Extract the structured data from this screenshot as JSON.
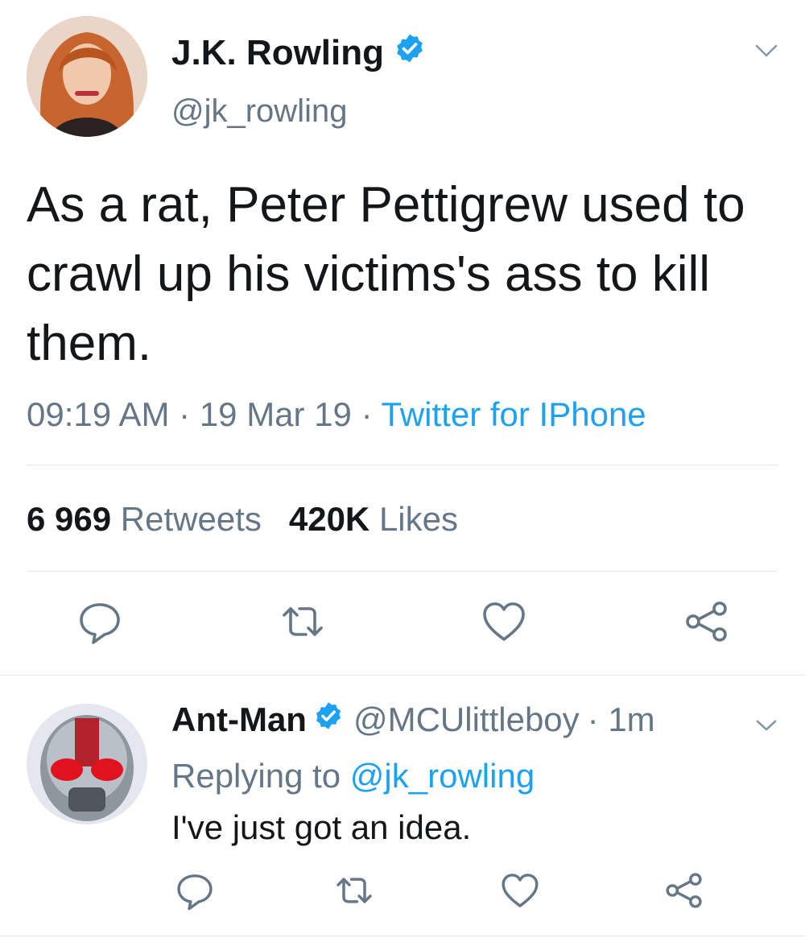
{
  "main_tweet": {
    "author_name": "J.K. Rowling",
    "author_handle": "@jk_rowling",
    "text": "As a rat, Peter Pettigrew used to crawl up his victims's ass to kill them.",
    "time": "09:19 AM",
    "date": "19 Mar 19",
    "separator": "·",
    "source": "Twitter for IPhone",
    "retweets_count": "6 969",
    "retweets_label": "Retweets",
    "likes_count": "420K",
    "likes_label": "Likes",
    "actions": [
      "reply-icon",
      "retweet-icon",
      "like-icon",
      "share-icon"
    ]
  },
  "reply": {
    "author_name": "Ant-Man",
    "author_handle": "@MCUlittleboy",
    "age": "· 1m",
    "replying_prefix": "Replying to",
    "replying_to": "@jk_rowling",
    "text": "I've just got an idea.",
    "actions": [
      "reply-icon",
      "retweet-icon",
      "like-icon",
      "share-icon"
    ]
  },
  "colors": {
    "text": "#14171a",
    "secondary": "#657786",
    "accent": "#1da1f2",
    "divider": "#e1e8ed"
  }
}
